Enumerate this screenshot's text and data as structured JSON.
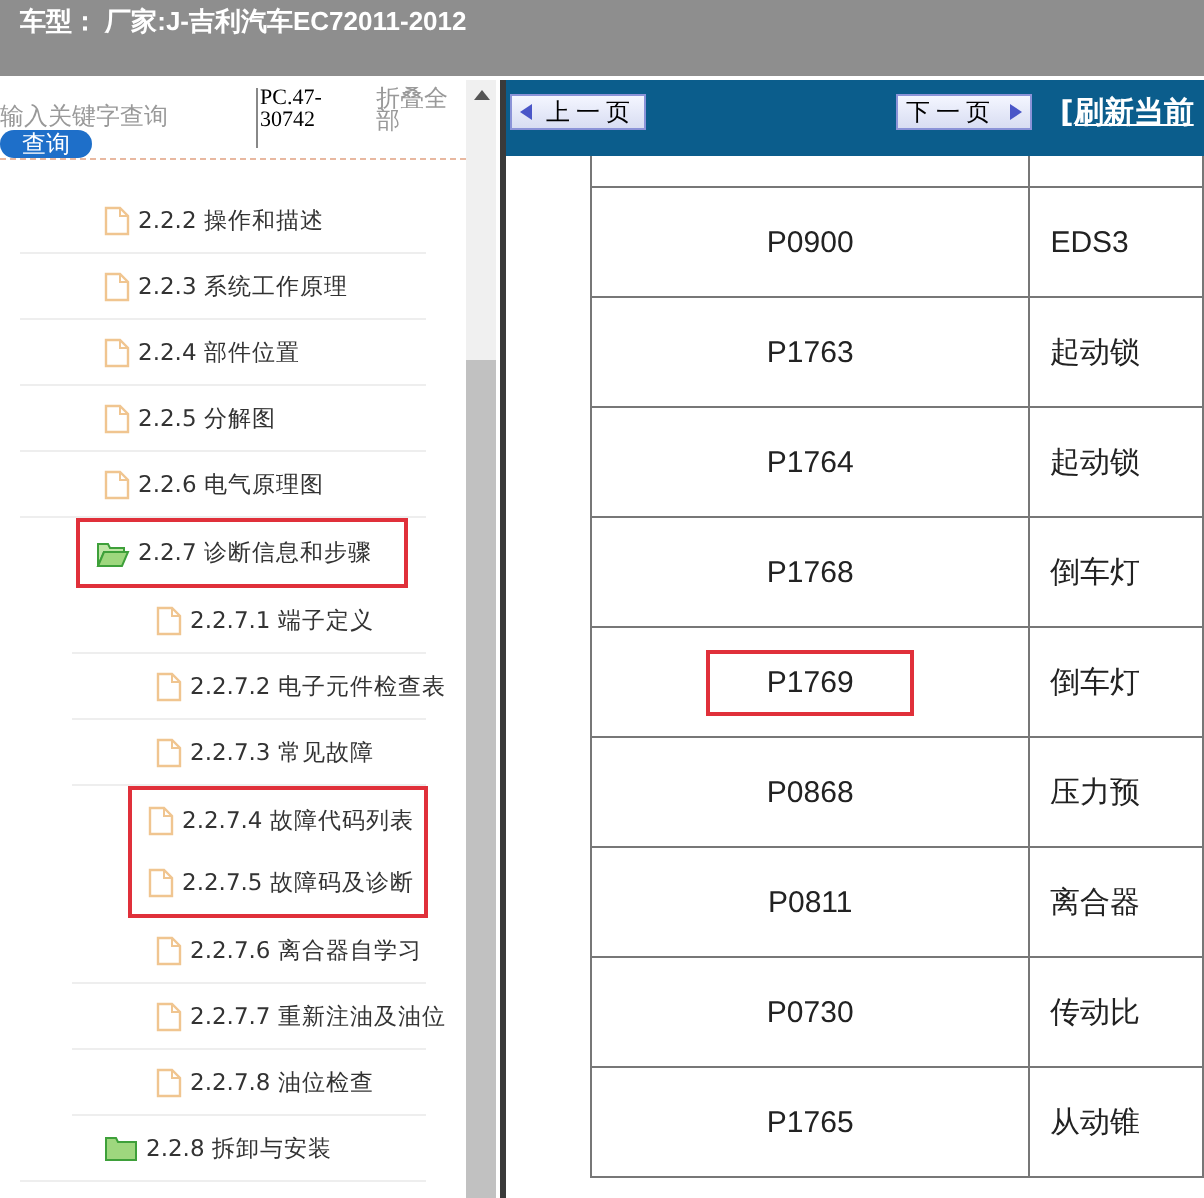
{
  "header": {
    "title": "车型： 厂家:J-吉利汽车EC72011-2012"
  },
  "sidebar": {
    "search": {
      "placeholder": "输入关键字查询"
    },
    "search_button": "查询",
    "code": "PC.47-30742",
    "collapse_all": "折叠全部",
    "tree": [
      {
        "label": "2.2.2 操作和描述",
        "kind": "file",
        "highlighted": false
      },
      {
        "label": "2.2.3 系统工作原理",
        "kind": "file",
        "highlighted": false
      },
      {
        "label": "2.2.4 部件位置",
        "kind": "file",
        "highlighted": false
      },
      {
        "label": "2.2.5 分解图",
        "kind": "file",
        "highlighted": false
      },
      {
        "label": "2.2.6 电气原理图",
        "kind": "file",
        "highlighted": false
      },
      {
        "label": "2.2.7 诊断信息和步骤",
        "kind": "folder",
        "expanded": true,
        "highlighted": true,
        "children": [
          {
            "label": "2.2.7.1 端子定义",
            "kind": "file",
            "highlighted": false
          },
          {
            "label": "2.2.7.2 电子元件检查表",
            "kind": "file",
            "highlighted": false
          },
          {
            "label": "2.2.7.3 常见故障",
            "kind": "file",
            "highlighted": false
          },
          {
            "label": "2.2.7.4 故障代码列表",
            "kind": "file",
            "highlighted": true
          },
          {
            "label": "2.2.7.5 故障码及诊断",
            "kind": "file",
            "highlighted": true
          },
          {
            "label": "2.2.7.6 离合器自学习",
            "kind": "file",
            "highlighted": false
          },
          {
            "label": "2.2.7.7 重新注油及油位",
            "kind": "file",
            "highlighted": false
          },
          {
            "label": "2.2.7.8 油位检查",
            "kind": "file",
            "highlighted": false
          }
        ]
      },
      {
        "label": "2.2.8 拆卸与安装",
        "kind": "folder",
        "expanded": false,
        "highlighted": false
      }
    ]
  },
  "toolbar": {
    "prev": "上一页",
    "next": "下一页",
    "refresh": "[刷新当前"
  },
  "table": {
    "rows": [
      {
        "code": "P0900",
        "description": "EDS3",
        "highlighted": false
      },
      {
        "code": "P1763",
        "description": "起动锁",
        "highlighted": false
      },
      {
        "code": "P1764",
        "description": "起动锁",
        "highlighted": false
      },
      {
        "code": "P1768",
        "description": "倒车灯",
        "highlighted": false
      },
      {
        "code": "P1769",
        "description": "倒车灯",
        "highlighted": true
      },
      {
        "code": "P0868",
        "description": "压力预",
        "highlighted": false
      },
      {
        "code": "P0811",
        "description": "离合器",
        "highlighted": false
      },
      {
        "code": "P0730",
        "description": "传动比",
        "highlighted": false
      },
      {
        "code": "P1765",
        "description": "从动锥",
        "highlighted": false
      }
    ]
  }
}
